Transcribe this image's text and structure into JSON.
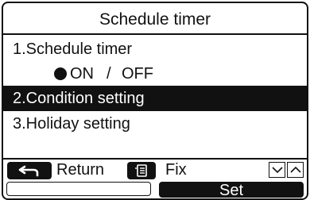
{
  "screen": {
    "title": "Schedule timer"
  },
  "menu": {
    "items": [
      {
        "label": "1.Schedule timer"
      },
      {
        "label": "2.Condition setting",
        "selected": true
      },
      {
        "label": "3.Holiday setting"
      }
    ],
    "schedule_toggle": {
      "on_label": "ON",
      "separator": "/",
      "off_label": "OFF",
      "selected": "ON"
    }
  },
  "footer": {
    "return_label": "Return",
    "fix_label": "Fix",
    "return_icon": "return-arrow-icon",
    "fix_icon": "menu-list-icon",
    "nav_icons": [
      "chevron-down-icon",
      "chevron-up-icon"
    ],
    "softkey_left_label": "",
    "softkey_right_label": "Set"
  },
  "colors": {
    "foreground": "#111111",
    "background": "#ffffff",
    "highlight": "#111111",
    "highlight_text": "#ffffff"
  }
}
